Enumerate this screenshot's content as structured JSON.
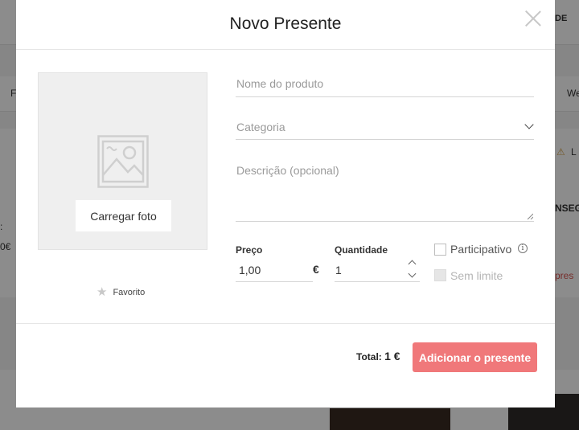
{
  "background": {
    "topbar_right_text": "DE",
    "left_nav_text": "F",
    "right_nav_text": "We",
    "left_price_text": "0€",
    "left_colon": ":",
    "right_alert_text": "L",
    "right_heading_text": "NSEG",
    "right_link_text": "pres"
  },
  "modal": {
    "title": "Novo Presente",
    "photo": {
      "upload_label": "Carregar foto",
      "favorite_label": "Favorito"
    },
    "form": {
      "name_placeholder": "Nome do produto",
      "category_value": "Categoria",
      "description_placeholder": "Descrição (opcional)",
      "price_label": "Preço",
      "price_value": "1,00",
      "currency_symbol": "€",
      "quantity_label": "Quantidade",
      "quantity_value": "1",
      "participative_label": "Participativo",
      "participative_checked": false,
      "unlimited_label": "Sem limite",
      "unlimited_disabled": true,
      "info_glyph": "i"
    },
    "footer": {
      "total_label": "Total:",
      "total_value": "1 €",
      "submit_label": "Adicionar o presente"
    }
  },
  "colors": {
    "accent": "#f0787a",
    "overlay": "rgba(0,0,0,0.45)"
  }
}
